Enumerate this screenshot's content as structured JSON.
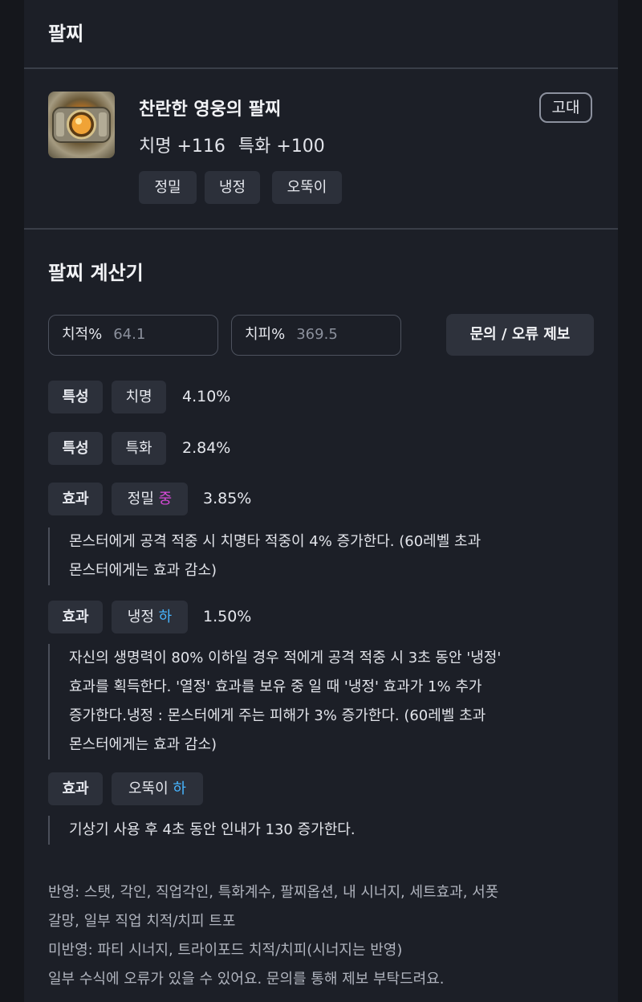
{
  "header": {
    "title": "팔찌"
  },
  "item": {
    "name": "찬란한 영웅의 팔찌",
    "grade": "고대",
    "stats": [
      "치명 +116",
      "특화 +100"
    ],
    "tags": [
      "정밀",
      "냉정",
      "오뚝이"
    ]
  },
  "calculator": {
    "title": "팔찌 계산기",
    "crit_rate_label": "치적%",
    "crit_rate_value": "64.1",
    "crit_dmg_label": "치피%",
    "crit_dmg_value": "369.5",
    "report_button": "문의 / 오류 제보",
    "rows": [
      {
        "type": "특성",
        "name": "치명",
        "grade": "",
        "value": "4.10%"
      },
      {
        "type": "특성",
        "name": "특화",
        "grade": "",
        "value": "2.84%"
      },
      {
        "type": "효과",
        "name": "정밀",
        "grade": "중",
        "value": "3.85%",
        "desc": [
          "몬스터에게 공격 적중 시 치명타 적중이 4% 증가한다. (60레벨 초과",
          "몬스터에게는 효과 감소)"
        ]
      },
      {
        "type": "효과",
        "name": "냉정",
        "grade": "하",
        "value": "1.50%",
        "desc": [
          "자신의 생명력이 80% 이하일 경우 적에게 공격 적중 시 3초 동안 '냉정'",
          "효과를 획득한다. '열정' 효과를 보유 중 일 때 '냉정' 효과가 1% 추가",
          "증가한다.냉정 : 몬스터에게 주는 피해가 3% 증가한다. (60레벨 초과",
          "몬스터에게는 효과 감소)"
        ]
      },
      {
        "type": "효과",
        "name": "오뚝이",
        "grade": "하",
        "value": "",
        "desc": [
          "기상기 사용 후 4초 동안 인내가 130 증가한다."
        ]
      }
    ]
  },
  "notes": [
    "반영: 스탯, 각인, 직업각인, 특화계수, 팔찌옵션, 내 시너지, 세트효과, 서폿",
    "갈망, 일부 직업 치적/치피 트포",
    "미반영: 파티 시너지, 트라이포드 치적/치피(시너지는 반영)",
    "일부 수식에 오류가 있을 수 있어요. 문의를 통해 제보 부탁드려요."
  ],
  "colors": {
    "grade_mid": "#d94ad9",
    "grade_low": "#47b5ff",
    "panel": "#1c1f27",
    "chip": "#2c303a"
  }
}
